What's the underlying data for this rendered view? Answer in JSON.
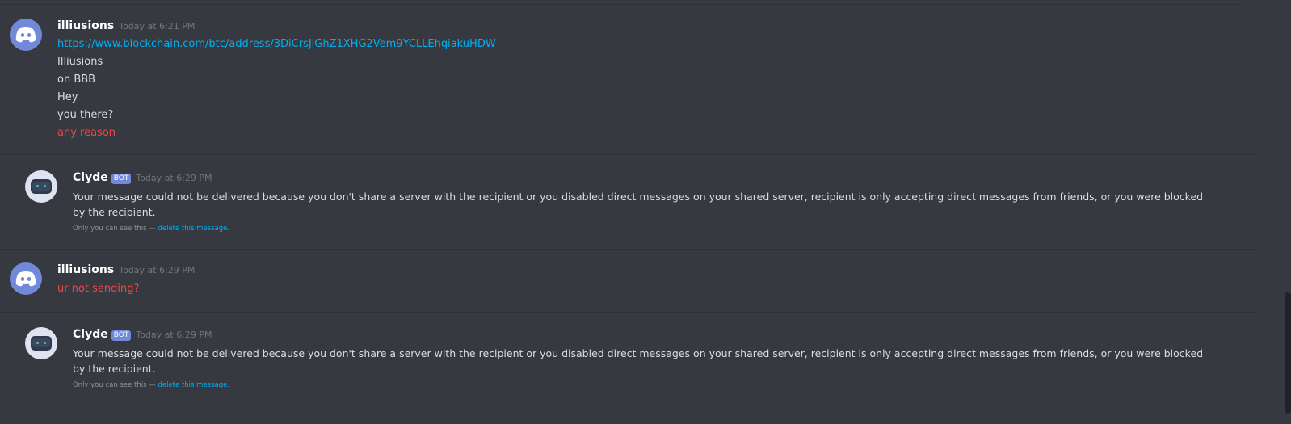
{
  "messages": [
    {
      "author": "illiusions",
      "timestamp": "Today at 6:21 PM",
      "avatar_icon": "discord-logo-icon",
      "lines": [
        {
          "text": "https://www.blockchain.com/btc/address/3DiCrsJiGhZ1XHG2Vem9YCLLEhqiakuHDW",
          "kind": "link"
        },
        {
          "text": "Illiusions",
          "kind": "normal"
        },
        {
          "text": "on BBB",
          "kind": "normal"
        },
        {
          "text": "Hey",
          "kind": "normal"
        },
        {
          "text": "you there?",
          "kind": "normal"
        },
        {
          "text": "any reason",
          "kind": "failed"
        }
      ]
    },
    {
      "author": "Clyde",
      "badge": "BOT",
      "timestamp": "Today at 6:29 PM",
      "avatar_icon": "clyde-robot-icon",
      "text": "Your message could not be delivered because you don't share a server with the recipient or you disabled direct messages on your shared server, recipient is only accepting direct messages from friends, or you were blocked by the recipient.",
      "note_prefix": "Only you can see this — ",
      "note_link": "delete this message",
      "note_suffix": "."
    },
    {
      "author": "illiusions",
      "timestamp": "Today at 6:29 PM",
      "avatar_icon": "discord-logo-icon",
      "lines": [
        {
          "text": "ur not sending?",
          "kind": "failed"
        }
      ]
    },
    {
      "author": "Clyde",
      "badge": "BOT",
      "timestamp": "Today at 6:29 PM",
      "avatar_icon": "clyde-robot-icon",
      "text": "Your message could not be delivered because you don't share a server with the recipient or you disabled direct messages on your shared server, recipient is only accepting direct messages from friends, or you were blocked by the recipient.",
      "note_prefix": "Only you can see this — ",
      "note_link": "delete this message",
      "note_suffix": "."
    }
  ],
  "colors": {
    "background": "#36393f",
    "link": "#00b0f4",
    "failed_message": "#f04747",
    "bot_badge": "#7289da",
    "timestamp": "#72767d"
  }
}
